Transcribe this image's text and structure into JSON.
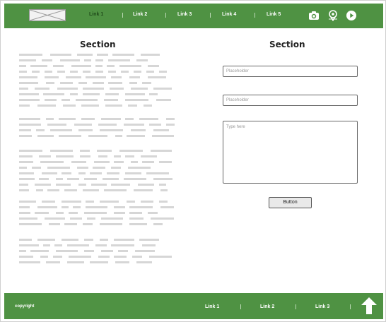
{
  "header": {
    "logo_icon": "image-placeholder-icon",
    "nav": [
      {
        "label": "Link 1",
        "active": true
      },
      {
        "label": "Link 2",
        "active": false
      },
      {
        "label": "Link 3",
        "active": false
      },
      {
        "label": "Link 4",
        "active": false
      },
      {
        "label": "Link 5",
        "active": false
      }
    ],
    "icons": [
      "camera-icon",
      "map-pin-icon",
      "play-icon"
    ]
  },
  "left": {
    "title": "Section"
  },
  "right": {
    "title": "Section",
    "input1_placeholder": "Placeholder",
    "input2_placeholder": "Placeholder",
    "textarea_placeholder": "Type here",
    "button_label": "Button"
  },
  "footer": {
    "copyright": "copyright",
    "links": [
      "Link 1",
      "Link 2",
      "Link 3"
    ],
    "icon": "arrow-up-icon"
  },
  "colors": {
    "brand_green": "#4f9243",
    "active_nav": "#1f4a1a",
    "placeholder_lines": "#d6d6d6"
  }
}
